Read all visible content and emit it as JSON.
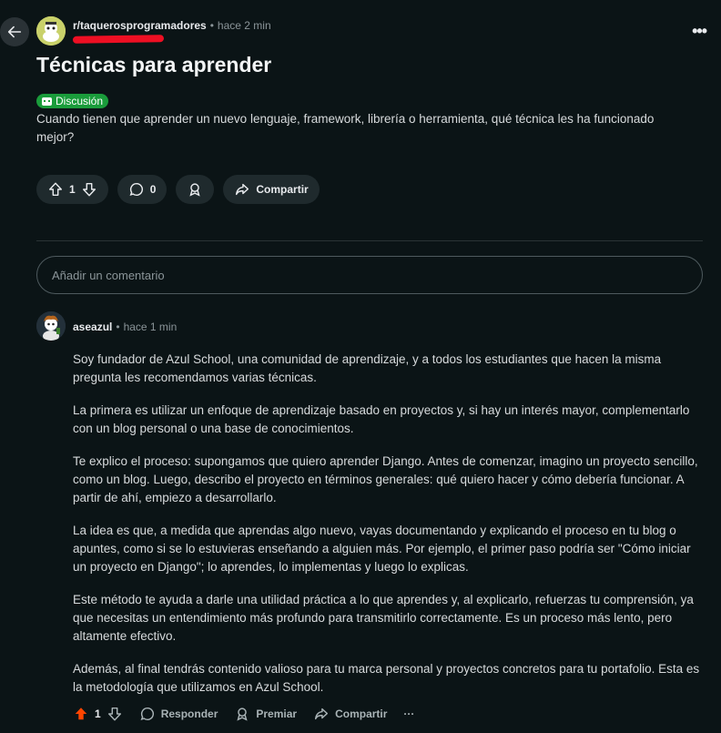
{
  "post": {
    "subreddit": "r/taquerosprogramadores",
    "time": "hace 2 min",
    "title": "Técnicas para aprender",
    "flair": "Discusión",
    "body": "Cuando tienen que aprender un nuevo lenguaje, framework, librería o herramienta, qué técnica les ha funcionado mejor?",
    "votes": "1",
    "comments": "0",
    "share_label": "Compartir"
  },
  "comment_input": {
    "placeholder": "Añadir un comentario"
  },
  "comment": {
    "user": "aseazul",
    "time": "hace 1 min",
    "paragraphs": [
      "Soy fundador de Azul School, una comunidad de aprendizaje, y a todos los estudiantes que hacen la misma pregunta les recomendamos varias técnicas.",
      "La primera es utilizar un enfoque de aprendizaje basado en proyectos y, si hay un interés mayor, complementarlo con un blog personal o una base de conocimientos.",
      "Te explico el proceso: supongamos que quiero aprender Django. Antes de comenzar, imagino un proyecto sencillo, como un blog. Luego, describo el proyecto en términos generales: qué quiero hacer y cómo debería funcionar. A partir de ahí, empiezo a desarrollarlo.",
      "La idea es que, a medida que aprendas algo nuevo, vayas documentando y explicando el proceso en tu blog o apuntes, como si se lo estuvieras enseñando a alguien más. Por ejemplo, el primer paso podría ser \"Cómo iniciar un proyecto en Django\"; lo aprendes, lo implementas y luego lo explicas.",
      "Este método te ayuda a darle una utilidad práctica a lo que aprendes y, al explicarlo, refuerzas tu comprensión, ya que necesitas un entendimiento más profundo para transmitirlo correctamente. Es un proceso más lento, pero altamente efectivo.",
      "Además, al final tendrás contenido valioso para tu marca personal y proyectos concretos para tu portafolio. Esta es la metodología que utilizamos en Azul School."
    ],
    "votes": "1",
    "reply_label": "Responder",
    "award_label": "Premiar",
    "share_label": "Compartir",
    "more_label": "···"
  },
  "colors": {
    "background": "#0b1416",
    "flair": "#1a9c3b",
    "upvote_active": "#ff4500",
    "redaction": "#ee0f23"
  }
}
